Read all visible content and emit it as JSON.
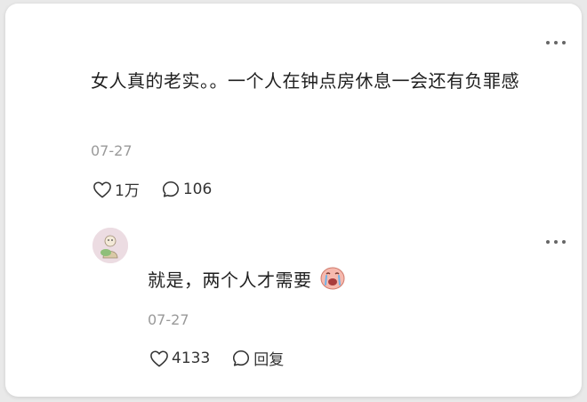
{
  "main_comment": {
    "text": "女人真的老实。。一个人在钟点房休息一会还有负罪感",
    "date": "07-27",
    "likes": "1万",
    "replies": "106",
    "icons": [
      "more-icon",
      "heart-icon",
      "comment-icon"
    ]
  },
  "reply_comment": {
    "text": "就是，两个人才需要",
    "date": "07-27",
    "likes": "4133",
    "reply_label": "回复",
    "icons": [
      "avatar",
      "more-icon",
      "heart-icon",
      "comment-icon",
      "crying-emoji-icon"
    ]
  },
  "colors": {
    "background": "#ffffff",
    "text": "#1f1f1f",
    "muted": "#9a9a9a"
  }
}
